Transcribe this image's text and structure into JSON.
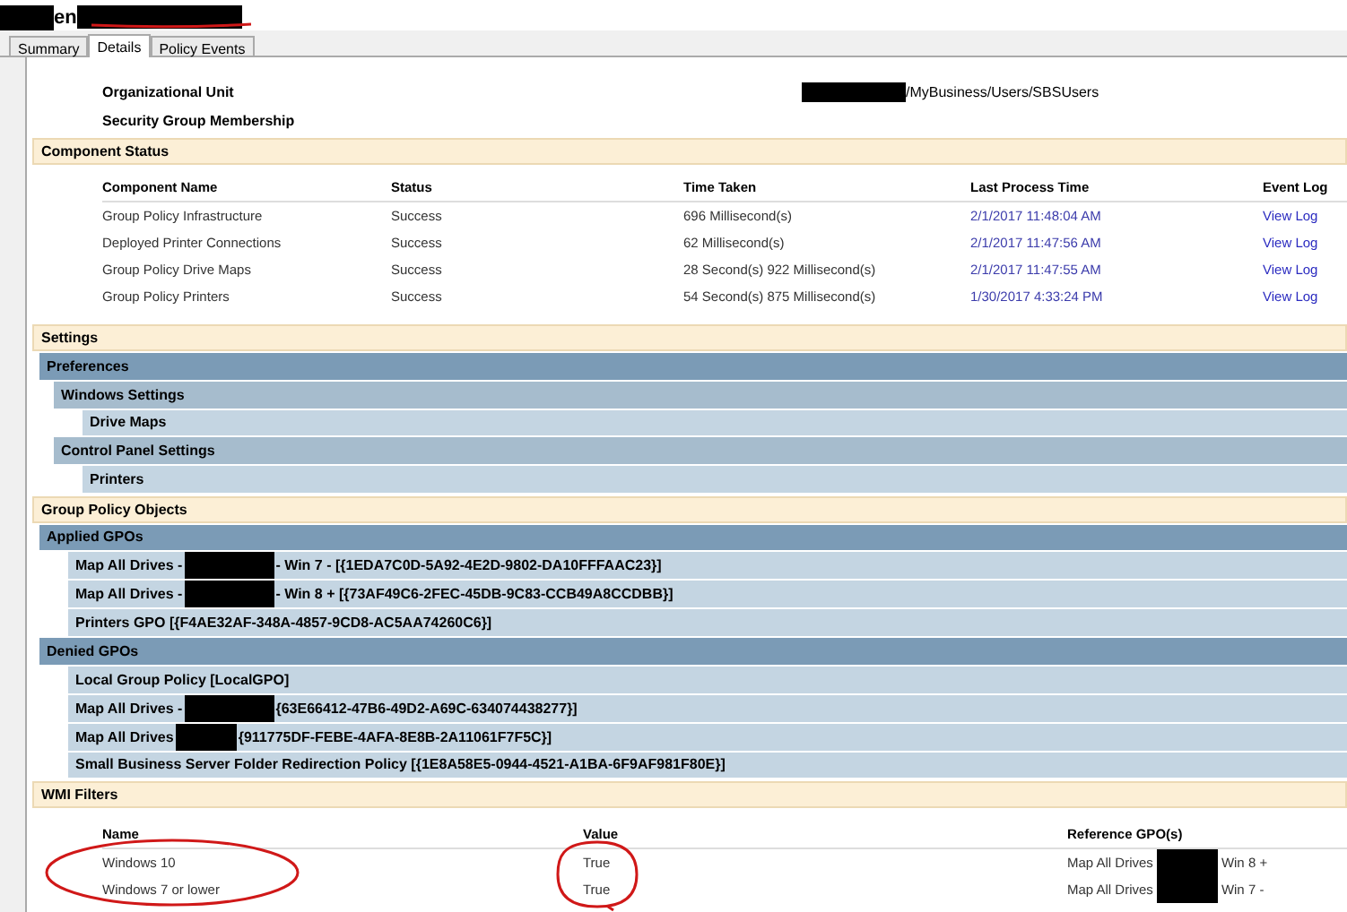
{
  "window": {
    "title": "en"
  },
  "tabs": [
    {
      "label": "Summary",
      "selected": false
    },
    {
      "label": "Details",
      "selected": true
    },
    {
      "label": "Policy Events",
      "selected": false
    }
  ],
  "info_rows": [
    {
      "label": "Organizational Unit",
      "value": "/MyBusiness/Users/SBSUsers"
    },
    {
      "label": "Security Group Membership"
    }
  ],
  "component_status": {
    "title": "Component Status",
    "columns": [
      "Component Name",
      "Status",
      "Time Taken",
      "Last Process Time",
      "Event Log"
    ],
    "rows": [
      {
        "name": "Group Policy Infrastructure",
        "status": "Success",
        "time": "696 Millisecond(s)",
        "last": "2/1/2017 11:48:04 AM",
        "log": "View Log"
      },
      {
        "name": "Deployed Printer Connections",
        "status": "Success",
        "time": "62 Millisecond(s)",
        "last": "2/1/2017 11:47:56 AM",
        "log": "View Log"
      },
      {
        "name": "Group Policy Drive Maps",
        "status": "Success",
        "time": "28 Second(s) 922 Millisecond(s)",
        "last": "2/1/2017 11:47:55 AM",
        "log": "View Log"
      },
      {
        "name": "Group Policy Printers",
        "status": "Success",
        "time": "54 Second(s) 875 Millisecond(s)",
        "last": "1/30/2017 4:33:24 PM",
        "log": "View Log"
      }
    ]
  },
  "sections": [
    {
      "title": "Settings",
      "children": [
        {
          "segments": [
            "Preferences"
          ],
          "children": [
            {
              "segments": [
                "Windows Settings"
              ],
              "children": [
                {
                  "segments": [
                    "Drive Maps"
                  ]
                }
              ]
            },
            {
              "segments": [
                "Control Panel Settings"
              ],
              "children": [
                {
                  "segments": [
                    "Printers"
                  ]
                }
              ]
            }
          ]
        }
      ]
    },
    {
      "title": "Group Policy Objects",
      "children": [
        {
          "segments": [
            "Applied GPOs"
          ],
          "children": [
            {
              "segments": [
                "Map All Drives -",
                "- Win 7 - [{1EDA7C0D-5A92-4E2D-9802-DA10FFFAAC23}]"
              ]
            },
            {
              "segments": [
                "Map All Drives -",
                "- Win 8 + [{73AF49C6-2FEC-45DB-9C83-CCB49A8CCDBB}]"
              ]
            },
            {
              "segments": [
                "Printers GPO [{F4AE32AF-348A-4857-9CD8-AC5AA74260C6}]"
              ]
            }
          ]
        },
        {
          "segments": [
            "Denied GPOs"
          ],
          "children": [
            {
              "segments": [
                "Local Group Policy [LocalGPO]"
              ]
            },
            {
              "segments": [
                "Map All Drives -",
                "{63E66412-47B6-49D2-A69C-634074438277}]"
              ]
            },
            {
              "segments": [
                "Map All Drives",
                "{911775DF-FEBE-4AFA-8E8B-2A11061F7F5C}]"
              ]
            },
            {
              "segments": [
                "Small Business Server Folder Redirection Policy [{1E8A58E5-0944-4521-A1BA-6F9AF981F80E}]"
              ]
            }
          ]
        }
      ]
    }
  ],
  "wmi": {
    "title": "WMI Filters",
    "columns": [
      "Name",
      "Value",
      "Reference GPO(s)"
    ],
    "rows": [
      {
        "name": "Windows 10",
        "value": "True",
        "ref": [
          "Map All Drives",
          "Win 8 +"
        ]
      },
      {
        "name": "Windows 7 or lower",
        "value": "True",
        "ref": [
          "Map All Drives",
          "Win 7 -"
        ]
      }
    ]
  }
}
